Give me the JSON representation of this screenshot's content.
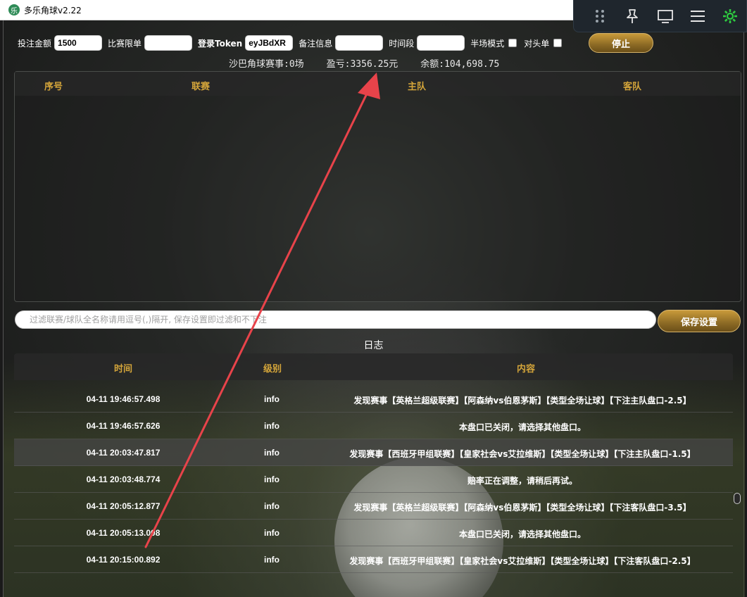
{
  "window": {
    "title": "多乐角球v2.22",
    "logo_char": "乐"
  },
  "overlay_toolbar": {
    "icons": [
      "drag-handle-icon",
      "pin-icon",
      "monitor-icon",
      "menu-icon",
      "settings-icon"
    ],
    "settings_color": "#2ecc40"
  },
  "controls": {
    "bet_amount_label": "投注金额",
    "bet_amount_value": "1500",
    "match_limit_label": "比赛限单",
    "match_limit_value": "",
    "token_label": "登录Token",
    "token_value": "eyJBdXR",
    "remark_label": "备注信息",
    "remark_value": "",
    "time_range_label": "时间段",
    "time_range_value": "",
    "half_mode_label": "半场模式",
    "hedge_label": "对头单",
    "stop_button": "停止"
  },
  "summary": {
    "matches": "沙巴角球赛事:0场",
    "profit": "盈亏:3356.25元",
    "balance": "余额:104,698.75"
  },
  "match_table": {
    "columns": [
      "序号",
      "联赛",
      "主队",
      "客队"
    ]
  },
  "filter": {
    "placeholder": "过滤联赛/球队全名称请用逗号(,)隔开, 保存设置即过滤和不下注",
    "save_button": "保存设置"
  },
  "log": {
    "title": "日志",
    "columns": [
      "时间",
      "级别",
      "内容"
    ],
    "rows": [
      {
        "time": "04-11 19:46:57.498",
        "level": "info",
        "content": "发现赛事【英格兰超级联赛】【阿森纳vs伯恩茅斯】【类型全场让球】【下注主队盘口-2.5】"
      },
      {
        "time": "04-11 19:46:57.626",
        "level": "info",
        "content": "本盘口已关闭，请选择其他盘口。"
      },
      {
        "time": "04-11 20:03:47.817",
        "level": "info",
        "content": "发现赛事【西班牙甲组联赛】【皇家社会vs艾拉维斯】【类型全场让球】【下注主队盘口-1.5】"
      },
      {
        "time": "04-11 20:03:48.774",
        "level": "info",
        "content": "赔率正在调整，请稍后再试。"
      },
      {
        "time": "04-11 20:05:12.877",
        "level": "info",
        "content": "发现赛事【英格兰超级联赛】【阿森纳vs伯恩茅斯】【类型全场让球】【下注客队盘口-3.5】"
      },
      {
        "time": "04-11 20:05:13.008",
        "level": "info",
        "content": "本盘口已关闭，请选择其他盘口。"
      },
      {
        "time": "04-11 20:15:00.892",
        "level": "info",
        "content": "发现赛事【西班牙甲组联赛】【皇家社会vs艾拉维斯】【类型全场让球】【下注客队盘口-2.5】"
      }
    ]
  },
  "colors": {
    "accent_gold": "#d4a53a",
    "annotation_arrow": "#e8434a"
  }
}
